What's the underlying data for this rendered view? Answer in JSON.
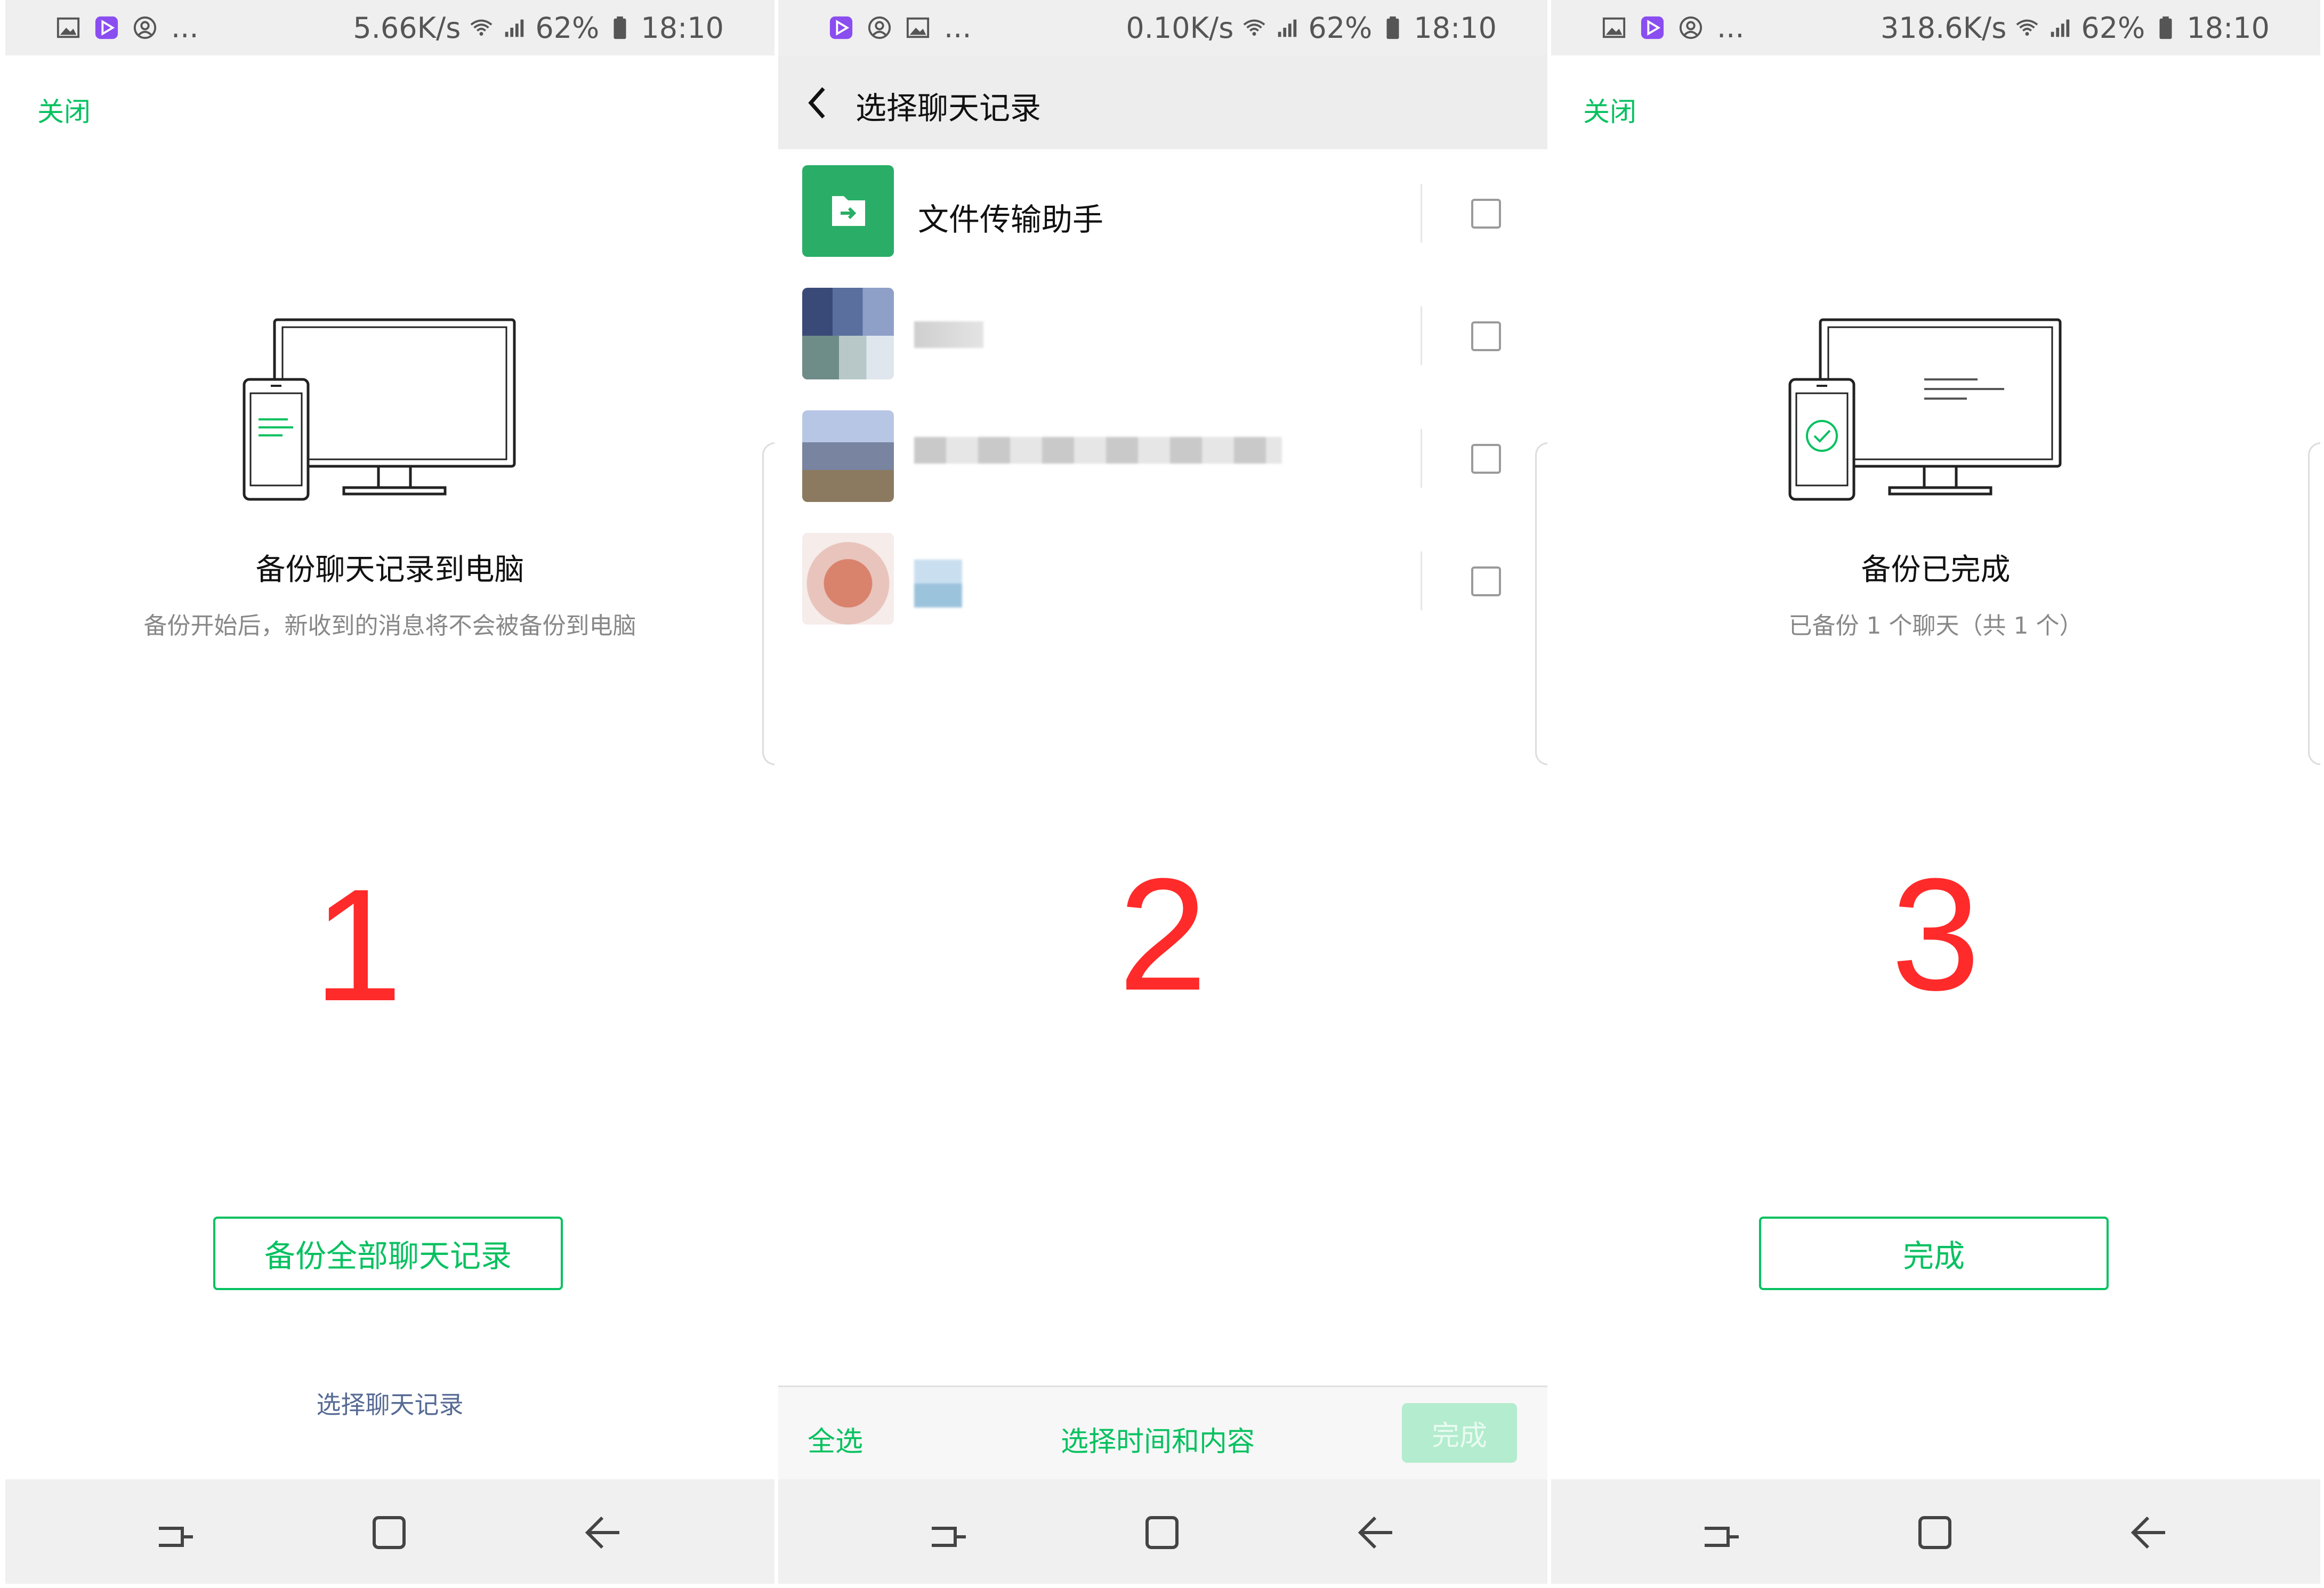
{
  "status_bars": [
    {
      "speed": "5.66K/s",
      "battery": "62%",
      "time": "18:10"
    },
    {
      "speed": "0.10K/s",
      "battery": "62%",
      "time": "18:10"
    },
    {
      "speed": "318.6K/s",
      "battery": "62%",
      "time": "18:10"
    }
  ],
  "status_more": "...",
  "screen1": {
    "close_label": "关闭",
    "title": "备份聊天记录到电脑",
    "subtitle": "备份开始后，新收到的消息将不会被备份到电脑",
    "step": "1",
    "backup_all_button": "备份全部聊天记录",
    "select_link": "选择聊天记录"
  },
  "screen2": {
    "title": "选择聊天记录",
    "chats": [
      {
        "name": "文件传输助手",
        "checked": false
      },
      {
        "name": "",
        "checked": false
      },
      {
        "name": "",
        "checked": false
      },
      {
        "name": "",
        "checked": false
      }
    ],
    "step": "2",
    "footer": {
      "select_all": "全选",
      "select_time": "选择时间和内容",
      "done": "完成"
    }
  },
  "screen3": {
    "close_label": "关闭",
    "title": "备份已完成",
    "subtitle": "已备份 1 个聊天（共 1 个）",
    "step": "3",
    "done_button": "完成"
  },
  "colors": {
    "accent": "#07c160",
    "step_number": "#ff2a2a",
    "link": "#576b95"
  }
}
